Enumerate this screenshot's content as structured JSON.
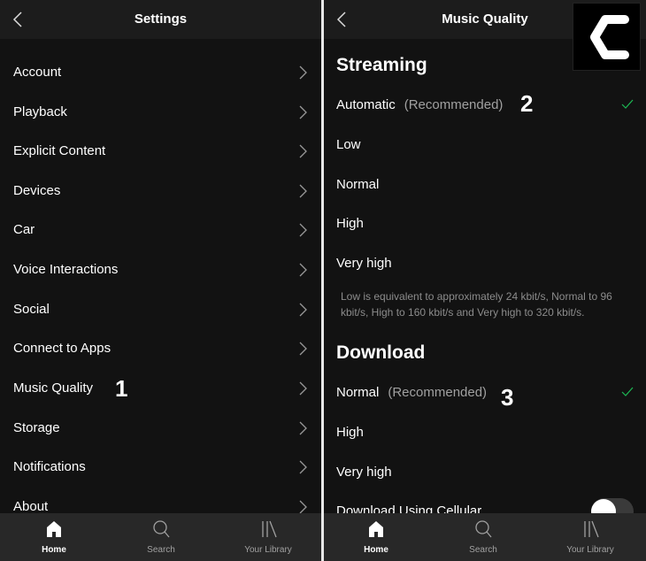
{
  "left": {
    "header": {
      "title": "Settings",
      "back_icon": "chevron-left-icon"
    },
    "items": [
      {
        "label": "Account"
      },
      {
        "label": "Playback"
      },
      {
        "label": "Explicit Content"
      },
      {
        "label": "Devices"
      },
      {
        "label": "Car"
      },
      {
        "label": "Voice Interactions"
      },
      {
        "label": "Social"
      },
      {
        "label": "Connect to Apps"
      },
      {
        "label": "Music Quality"
      },
      {
        "label": "Storage"
      },
      {
        "label": "Notifications"
      },
      {
        "label": "About"
      }
    ],
    "marker": "1"
  },
  "right": {
    "header": {
      "title": "Music Quality",
      "back_icon": "chevron-left-icon"
    },
    "streaming": {
      "title": "Streaming",
      "options": [
        {
          "label": "Automatic",
          "note": "(Recommended)",
          "selected": true
        },
        {
          "label": "Low",
          "note": "",
          "selected": false
        },
        {
          "label": "Normal",
          "note": "",
          "selected": false
        },
        {
          "label": "High",
          "note": "",
          "selected": false
        },
        {
          "label": "Very high",
          "note": "",
          "selected": false
        }
      ],
      "description": "Low is equivalent to approximately 24 kbit/s, Normal to 96 kbit/s, High to 160 kbit/s and Very high to 320 kbit/s.",
      "marker": "2"
    },
    "download": {
      "title": "Download",
      "options": [
        {
          "label": "Normal",
          "note": "(Recommended)",
          "selected": true
        },
        {
          "label": "High",
          "note": "",
          "selected": false
        },
        {
          "label": "Very high",
          "note": "",
          "selected": false
        }
      ],
      "cellular_label": "Download Using Cellular",
      "cellular_enabled": false,
      "marker": "3"
    }
  },
  "tabbar": {
    "tabs": [
      {
        "label": "Home",
        "icon": "home-icon",
        "active": true
      },
      {
        "label": "Search",
        "icon": "search-icon",
        "active": false
      },
      {
        "label": "Your Library",
        "icon": "library-icon",
        "active": false
      }
    ]
  },
  "colors": {
    "accent_check": "#1db954",
    "background": "#121212",
    "header": "#1c1c1c",
    "tabbar": "#282828"
  }
}
